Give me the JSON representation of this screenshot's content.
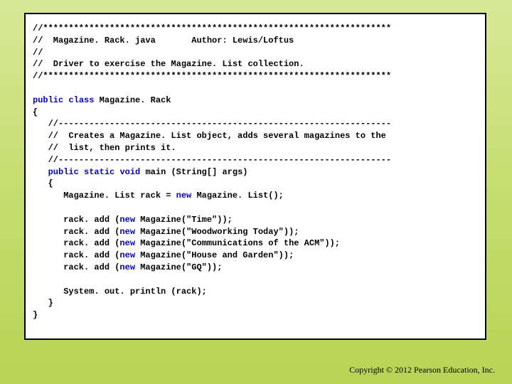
{
  "code": {
    "l1": "//********************************************************************",
    "l2a": "//  Magazine. Rack. java       Author: Lewis/Loftus",
    "l3": "//",
    "l4": "//  Driver to exercise the Magazine. List collection.",
    "l5": "//********************************************************************",
    "kw_public": "public",
    "kw_class": "class",
    "kw_static": "static",
    "kw_void": "void",
    "kw_new": "new",
    "classname": "Magazine. Rack",
    "ob": "{",
    "cb": "}",
    "c1": "   //-----------------------------------------------------------------",
    "c2": "   //  Creates a Magazine. List object, adds several magazines to the",
    "c3": "   //  list, then prints it.",
    "c4": "   //-----------------------------------------------------------------",
    "main_sig": " main (String[] args)",
    "ob2": "   {",
    "cb2": "   }",
    "decl1a": "      Magazine. List rack = ",
    "decl1b": " Magazine. List();",
    "add_pre": "      rack. add (",
    "add1": " Magazine(\"Time\"));",
    "add2": " Magazine(\"Woodworking Today\"));",
    "add3": " Magazine(\"Communications of the ACM\"));",
    "add4": " Magazine(\"House and Garden\"));",
    "add5": " Magazine(\"GQ\"));",
    "println": "      System. out. println (rack);"
  },
  "footer": {
    "copyright": "Copyright © 2012 Pearson Education, Inc."
  }
}
